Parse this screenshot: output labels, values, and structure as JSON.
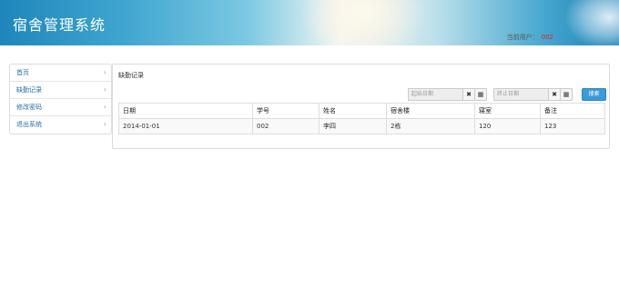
{
  "header": {
    "app_title": "宿舍管理系统",
    "user_label": "当前用户：",
    "user_value": "002"
  },
  "sidebar": {
    "items": [
      {
        "label": "首页"
      },
      {
        "label": "缺勤记录"
      },
      {
        "label": "修改密码"
      },
      {
        "label": "退出系统"
      }
    ]
  },
  "panel": {
    "title": "缺勤记录",
    "start_date_placeholder": "起始日期",
    "end_date_placeholder": "终止日期",
    "search_label": "搜索"
  },
  "table": {
    "headers": [
      "日期",
      "学号",
      "姓名",
      "宿舍楼",
      "寝室",
      "备注"
    ],
    "rows": [
      [
        "2014-01-01",
        "002",
        "李四",
        "2栋",
        "120",
        "123"
      ]
    ]
  },
  "icons": {
    "chevron": "chevron-right-icon",
    "clear": "clear-icon",
    "calendar": "calendar-icon"
  }
}
